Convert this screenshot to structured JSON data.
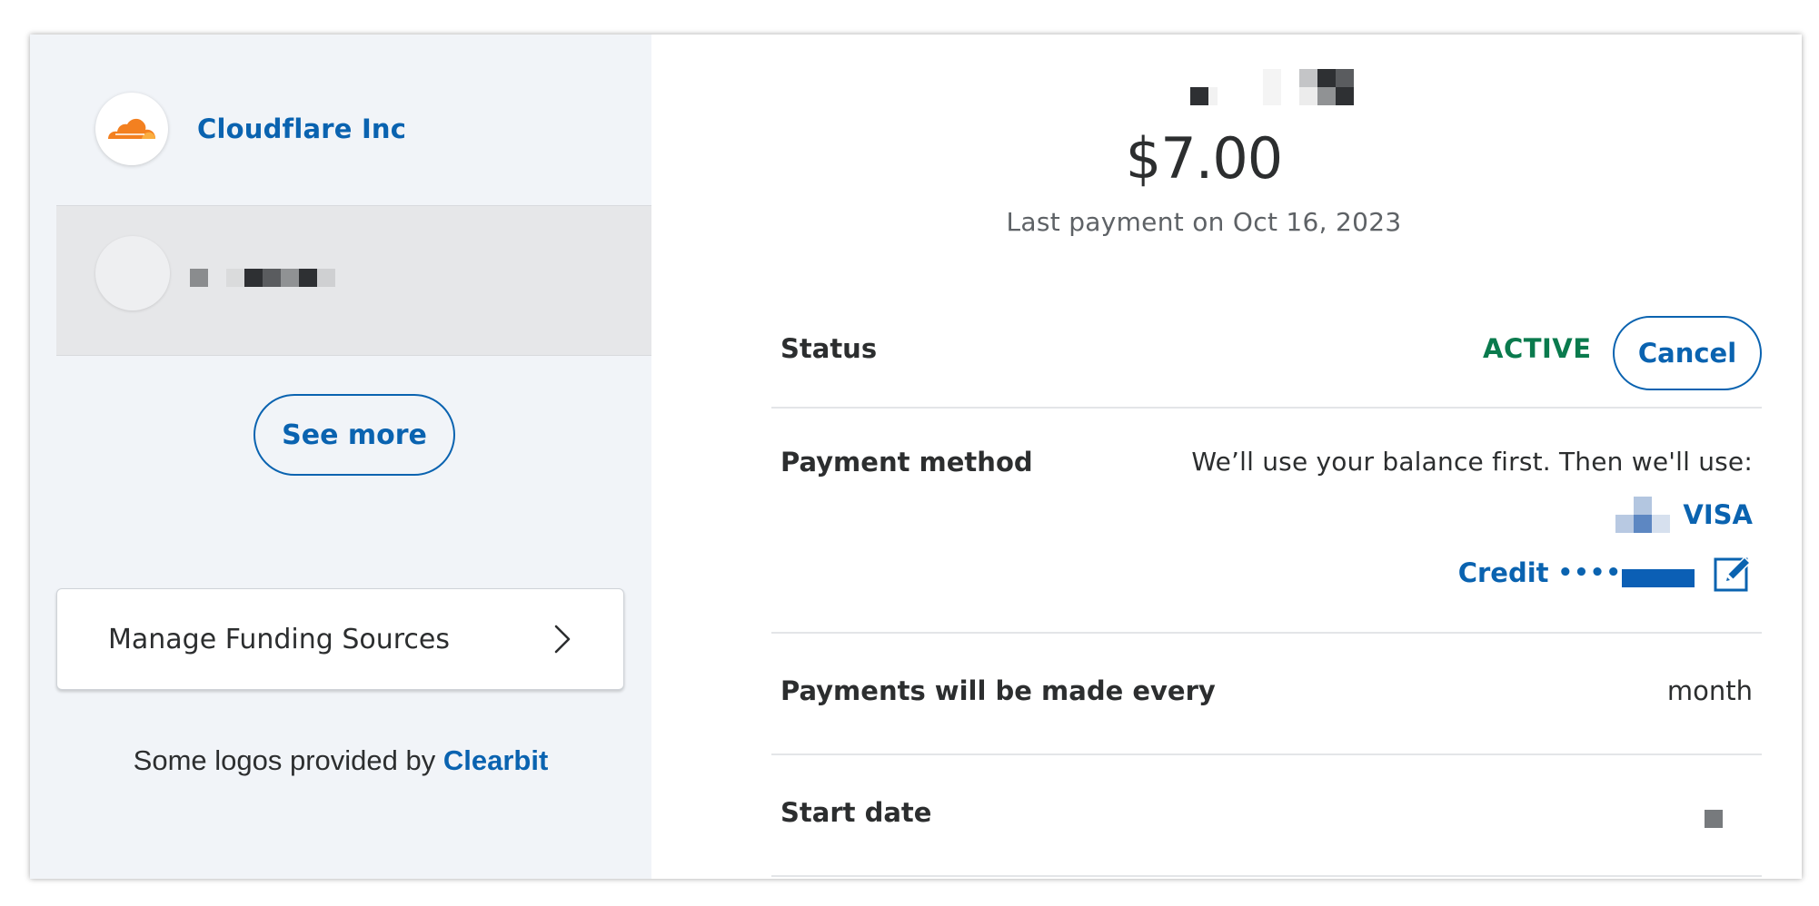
{
  "merchant": {
    "name": "Cloudflare Inc",
    "logo_icon": "cloudflare-cloud-logo",
    "brand_color": "#f48120"
  },
  "sidebar": {
    "see_more_label": "See more",
    "manage_funding_label": "Manage Funding Sources",
    "clearbit_prefix": "Some logos provided by",
    "clearbit_link": "Clearbit"
  },
  "subscription": {
    "amount": "$7.00",
    "last_payment": "Last payment on Oct 16, 2023",
    "status": {
      "label": "Status",
      "value": "ACTIVE",
      "value_color": "#0a7a4d",
      "cancel_label": "Cancel"
    },
    "payment_method": {
      "label": "Payment method",
      "note": "We’ll use your balance first. Then we'll use:",
      "card_brand": "VISA",
      "card_type": "Credit",
      "masked_prefix": "••••",
      "edit_icon": "edit-icon"
    },
    "frequency": {
      "label": "Payments will be made every",
      "value": "month"
    },
    "start_date": {
      "label": "Start date"
    }
  },
  "colors": {
    "link_blue": "#0a63b0",
    "sidebar_bg": "#f1f4f8"
  }
}
